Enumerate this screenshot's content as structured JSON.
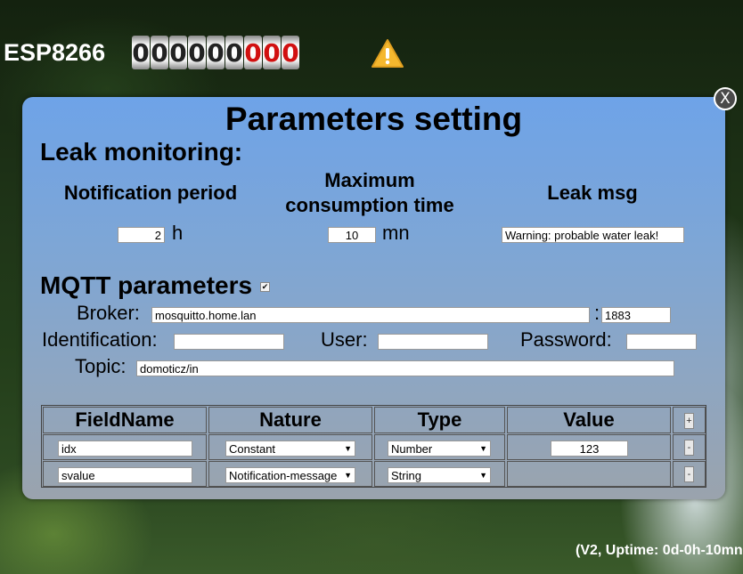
{
  "header": {
    "app_title": "ESP8266",
    "counter_digits": [
      "0",
      "0",
      "0",
      "0",
      "0",
      "0",
      "0",
      "0",
      "0"
    ],
    "counter_red_from_index": 6,
    "warning_icon": "warning-triangle-icon"
  },
  "dialog": {
    "close_label": "X",
    "title": "Parameters setting",
    "leak": {
      "section_title": "Leak monitoring:",
      "notification_period_label": "Notification period",
      "max_consumption_label_line1": "Maximum",
      "max_consumption_label_line2": "consumption time",
      "leak_msg_label": "Leak msg",
      "notification_period_value": "2",
      "notification_period_unit": "h",
      "max_consumption_value": "10",
      "max_consumption_unit": "mn",
      "leak_msg_value": "Warning: probable water leak!"
    },
    "mqtt": {
      "section_title": "MQTT parameters",
      "enabled": true,
      "broker_label": "Broker:",
      "broker_value": "mosquitto.home.lan",
      "port_separator": ":",
      "port_value": "1883",
      "identification_label": "Identification:",
      "identification_value": "",
      "user_label": "User:",
      "user_value": "",
      "password_label": "Password:",
      "password_value": "",
      "topic_label": "Topic:",
      "topic_value": "domoticz/in"
    },
    "table": {
      "headers": [
        "FieldName",
        "Nature",
        "Type",
        "Value"
      ],
      "add_label": "+",
      "remove_label": "-",
      "rows": [
        {
          "fieldname": "idx",
          "nature": "Constant",
          "type": "Number",
          "value": "123"
        },
        {
          "fieldname": "svalue",
          "nature": "Notification-message",
          "type": "String",
          "value": ""
        }
      ]
    }
  },
  "footer": {
    "uptime_text": "(V2, Uptime: 0d-0h-10mn"
  },
  "colors": {
    "panel_top": "#6ea3e8",
    "panel_bottom": "#9aa3ad",
    "counter_red": "#d11010",
    "warning_yellow": "#f5b82e"
  }
}
